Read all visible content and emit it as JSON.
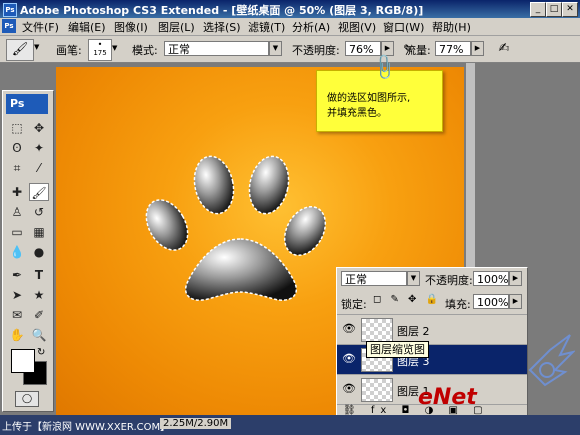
{
  "titlebar": {
    "app_title": "Adobe Photoshop CS3 Extended - [壁纸桌面 @ 50% (图层 3, RGB/8)]"
  },
  "menu": {
    "items": [
      "文件(F)",
      "编辑(E)",
      "图像(I)",
      "图层(L)",
      "选择(S)",
      "滤镜(T)",
      "分析(A)",
      "视图(V)",
      "窗口(W)",
      "帮助(H)"
    ]
  },
  "options": {
    "brush_label": "画笔:",
    "brush_size": "175",
    "mode_label": "模式:",
    "mode_value": "正常",
    "opacity_label": "不透明度:",
    "opacity_value": "76%",
    "flow_label": "流量:",
    "flow_value": "77%"
  },
  "toolbox": {
    "logo": "Ps"
  },
  "note": {
    "line1": "做的选区如图所示,",
    "line2": "并填充黑色。"
  },
  "layers": {
    "blend_mode": "正常",
    "opacity_label": "不透明度:",
    "opacity_value": "100%",
    "lock_label": "锁定:",
    "fill_label": "填充:",
    "fill_value": "100%",
    "rows": [
      {
        "name": "图层 2",
        "selected": false
      },
      {
        "name": "图层 3",
        "selected": true
      },
      {
        "name": "图层 1",
        "selected": false
      }
    ],
    "tooltip": "图层缩览图"
  },
  "status": {
    "caption": "上传于【新浪网 WWW.XXER.COM】",
    "doc_size": "2.25M/2.90M"
  },
  "watermark": {
    "text": "eNet"
  },
  "colors": {
    "canvas": "#f39a0a",
    "note": "#ffff3a",
    "selected_layer": "#0a246a"
  }
}
